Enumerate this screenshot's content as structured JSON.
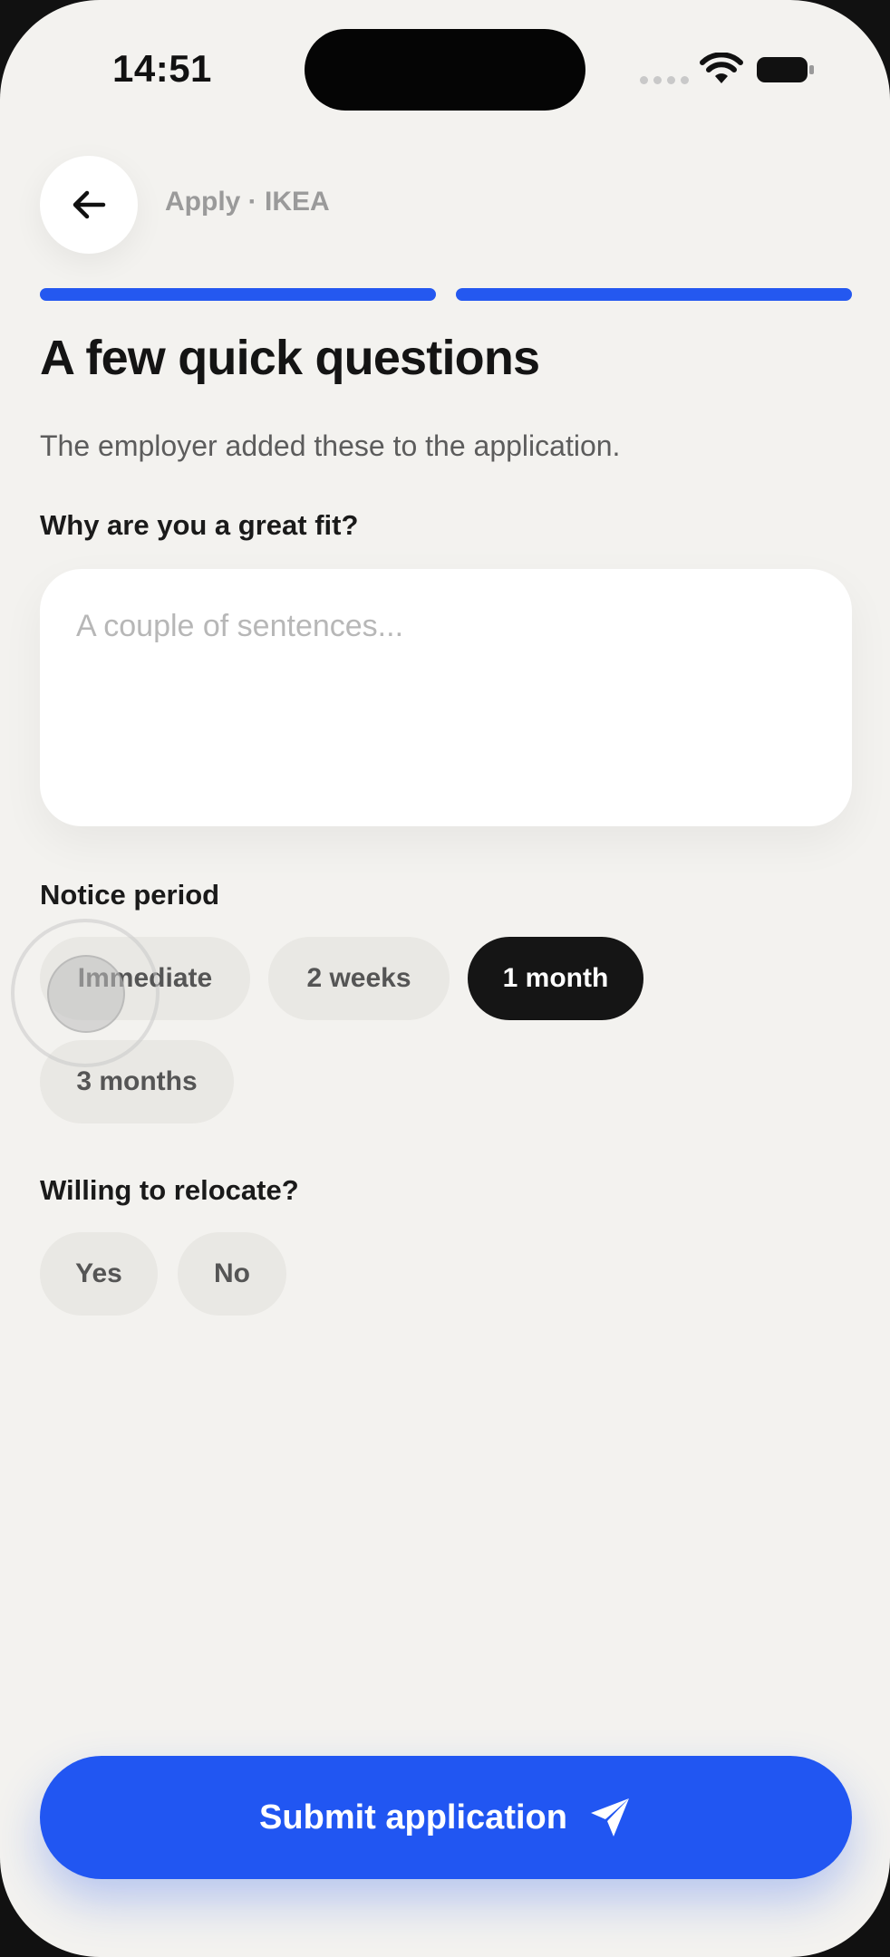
{
  "status_bar": {
    "time": "14:51"
  },
  "header": {
    "back_icon": "arrow-left-icon",
    "title": "Apply · IKEA"
  },
  "progress": {
    "total_steps": 2,
    "completed_steps": 2,
    "active_color": "#2458f0"
  },
  "page": {
    "title": "A few quick questions",
    "subtitle": "The employer added these to the application."
  },
  "questions": {
    "fit": {
      "label": "Why are you a great fit?",
      "placeholder": "A couple of sentences...",
      "value": ""
    },
    "notice": {
      "label": "Notice period",
      "options": [
        "Immediate",
        "2 weeks",
        "1 month",
        "3 months"
      ],
      "selected": "1 month"
    },
    "relocate": {
      "label": "Willing to relocate?",
      "options": [
        "Yes",
        "No"
      ],
      "selected": ""
    }
  },
  "submit": {
    "label": "Submit application",
    "icon": "send-icon",
    "color": "#2156f2"
  }
}
